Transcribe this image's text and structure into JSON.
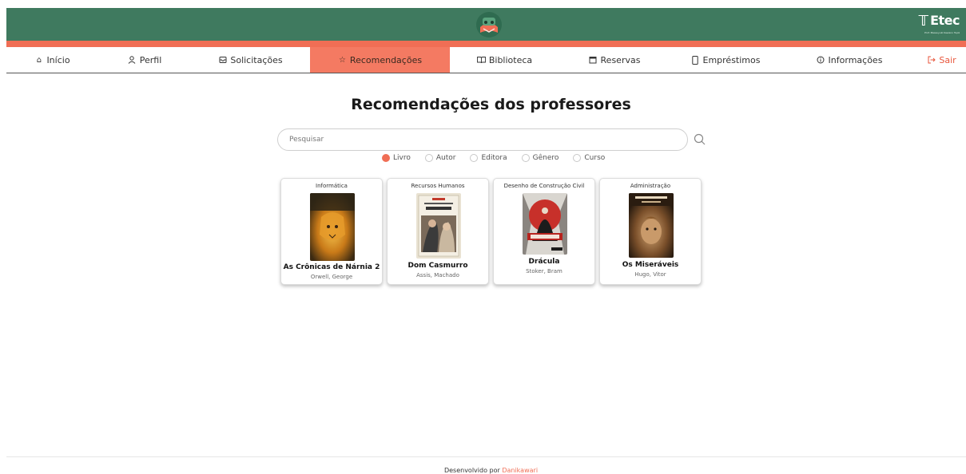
{
  "header": {
    "brand": "Etec",
    "brand_sub": "Prof. Massuyuki Kawano Tupã"
  },
  "nav": {
    "items": [
      {
        "label": "Início",
        "icon": "home-icon"
      },
      {
        "label": "Perfil",
        "icon": "user-icon"
      },
      {
        "label": "Solicitações",
        "icon": "inbox-icon"
      },
      {
        "label": "Recomendações",
        "icon": "star-icon",
        "active": true
      },
      {
        "label": "Biblioteca",
        "icon": "book-open-icon"
      },
      {
        "label": "Reservas",
        "icon": "calendar-icon"
      },
      {
        "label": "Empréstimos",
        "icon": "phone-icon"
      },
      {
        "label": "Informações",
        "icon": "info-icon"
      },
      {
        "label": "Sair",
        "icon": "logout-icon"
      }
    ]
  },
  "main": {
    "title": "Recomendações dos professores",
    "search": {
      "placeholder": "Pesquisar",
      "value": ""
    },
    "filters": [
      {
        "label": "Livro",
        "checked": true
      },
      {
        "label": "Autor",
        "checked": false
      },
      {
        "label": "Editora",
        "checked": false
      },
      {
        "label": "Gênero",
        "checked": false
      },
      {
        "label": "Curso",
        "checked": false
      }
    ],
    "books": [
      {
        "course": "Informática",
        "title": "As Crônicas de Nárnia 2",
        "author": "Orwell, George"
      },
      {
        "course": "Recursos Humanos",
        "title": "Dom Casmurro",
        "author": "Assis, Machado"
      },
      {
        "course": "Desenho de Construção Civil",
        "title": "Drácula",
        "author": "Stoker, Bram"
      },
      {
        "course": "Administração",
        "title": "Os Miseráveis",
        "author": "Hugo, Vitor"
      }
    ]
  },
  "footer": {
    "text": "Desenvolvido por",
    "author": "Danikawari"
  },
  "colors": {
    "header_green": "#3f7a5f",
    "accent": "#f06e55",
    "active_tab": "#f47a62"
  }
}
